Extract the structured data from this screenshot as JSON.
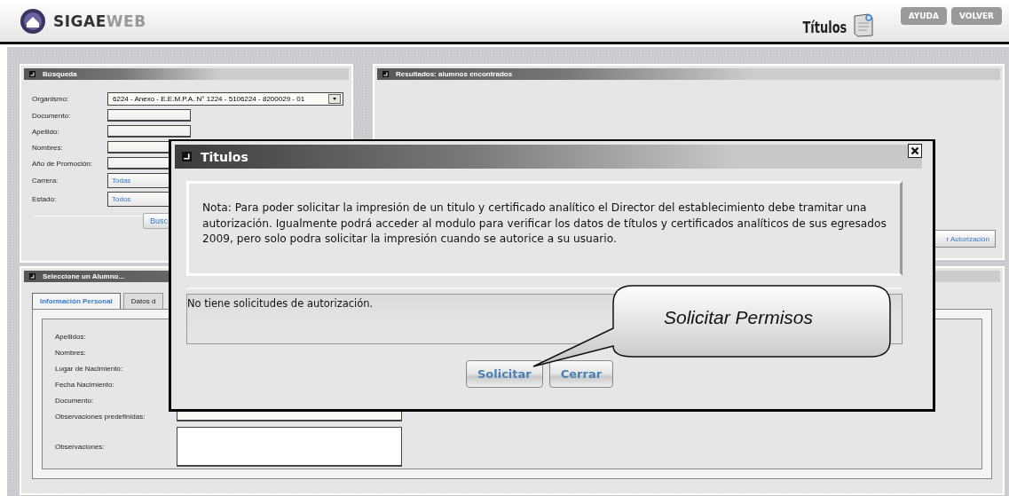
{
  "header": {
    "brand": {
      "primary": "SIGAE",
      "secondary": "WEB"
    },
    "page_title": "Títulos",
    "buttons": [
      "AYUDA",
      "VOLVER"
    ]
  },
  "search_panel": {
    "title": "Búsqueda",
    "fields": [
      {
        "label": "Organismo:",
        "kind": "select",
        "value": "6224 - Anexo - E.E.M.P.A. N° 1224 - 5106224 - 8200029 - 01"
      },
      {
        "label": "Documento:",
        "kind": "text"
      },
      {
        "label": "Apellido:",
        "kind": "text"
      },
      {
        "label": "Nombres:",
        "kind": "text"
      },
      {
        "label": "Año de Promoción:",
        "kind": "text"
      },
      {
        "label": "Carrera:",
        "kind": "choice",
        "value": "Todas"
      },
      {
        "label": "Estado:",
        "kind": "choice",
        "value": "Todos"
      }
    ],
    "button": "Busc"
  },
  "results_panel": {
    "title": "Resultados: alumnos encontrados",
    "button": "r Autorización"
  },
  "student_panel": {
    "title": "Seleccione un Alumno...",
    "tabs": [
      {
        "label": "Información Personal",
        "selected": true
      },
      {
        "label": "Datos d",
        "selected": false
      }
    ],
    "fields": [
      {
        "label": "Apellidos:",
        "kind": "plain"
      },
      {
        "label": "Nombres:",
        "kind": "plain"
      },
      {
        "label": "Lugar de Nacimiento:",
        "kind": "plain"
      },
      {
        "label": "Fecha Nacimiento:",
        "kind": "plain"
      },
      {
        "label": "Documento:",
        "kind": "plain"
      },
      {
        "label": "Observaciones predefinidas:",
        "kind": "select"
      },
      {
        "label": "Observaciones:",
        "kind": "textarea"
      }
    ]
  },
  "dialog": {
    "title": "Titulos",
    "note": "Nota: Para poder solicitar la impresión de un titulo y certificado analítico el Director del establecimiento debe tramitar una autorización. Igualmente podrá acceder al modulo para verificar los datos de títulos y certificados analíticos de sus egresados 2009, pero solo podra solicitar la impresión cuando se autorice a su usuario.",
    "requests_message": "No tiene solicitudes de autorización.",
    "buttons": [
      "Solicitar",
      "Cerrar"
    ]
  },
  "callout": {
    "text": "Solicitar Permisos"
  }
}
